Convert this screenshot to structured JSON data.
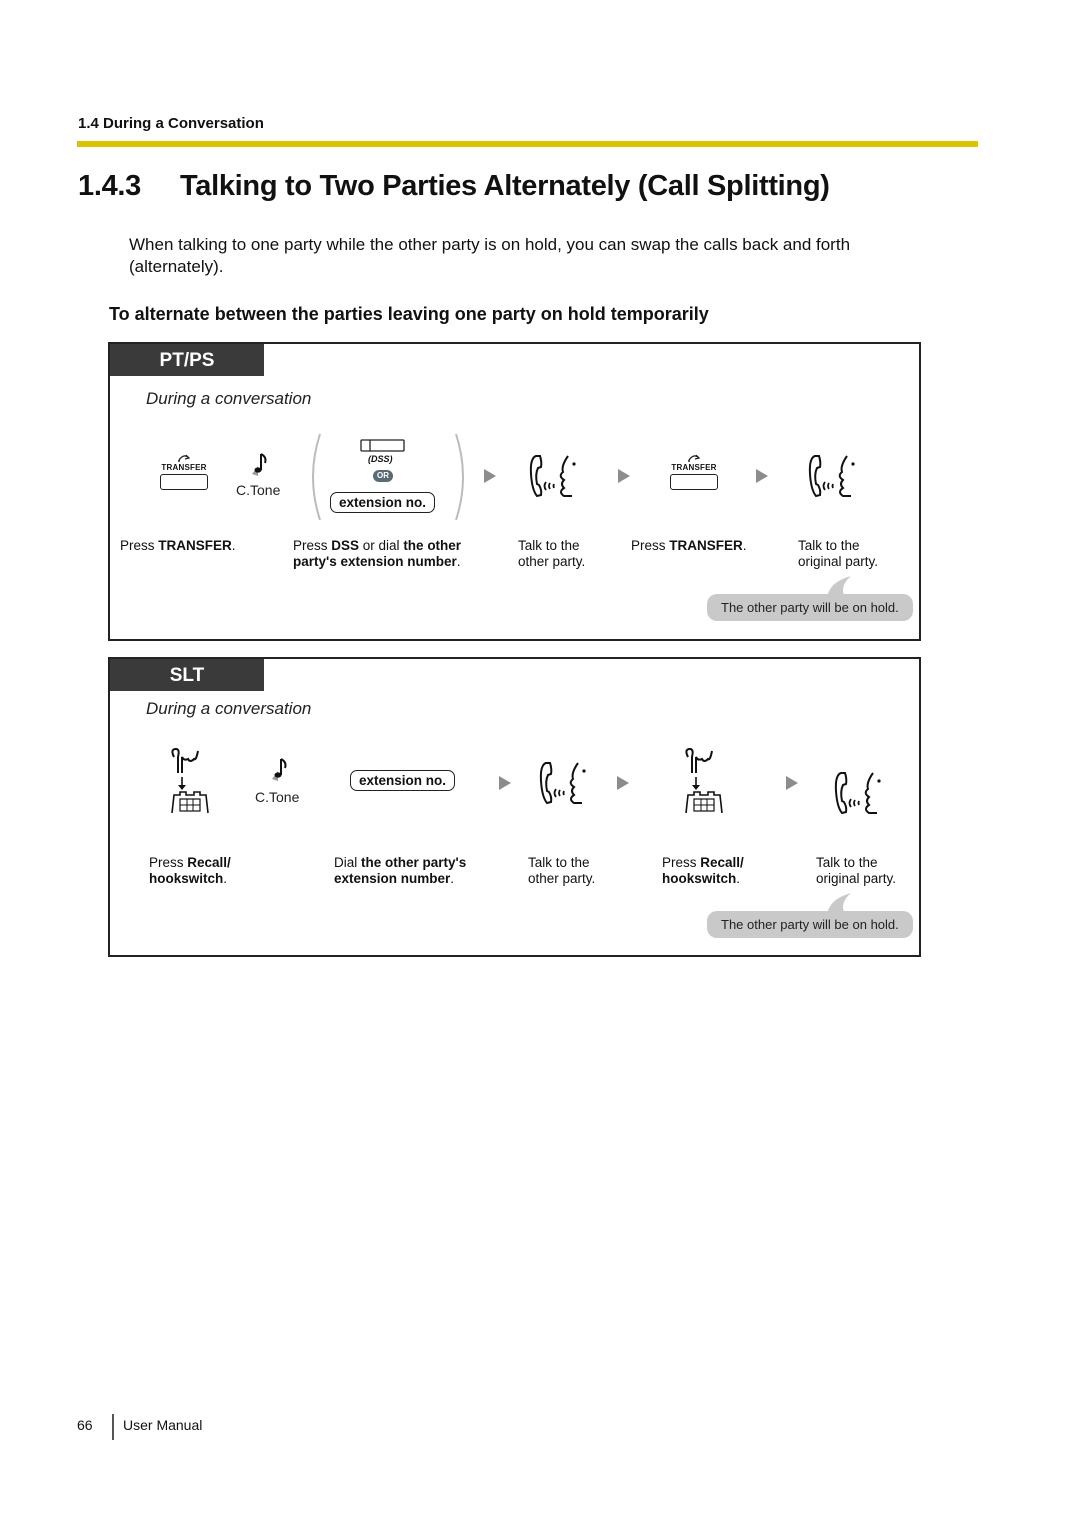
{
  "header": {
    "section": "1.4 During a Conversation",
    "accent_color": "#dcc200"
  },
  "title": {
    "number": "1.4.3",
    "text": "Talking to Two Parties Alternately (Call Splitting)"
  },
  "intro": "When talking to one party while the other party is on hold, you can swap the calls back and forth (alternately).",
  "subheading": "To alternate between the parties leaving one party on hold temporarily",
  "pt_panel": {
    "tag": "PT/PS",
    "condition": "During a conversation",
    "icons": {
      "transfer_label": "TRANSFER",
      "ctone_label": "C.Tone",
      "dss_label": "(DSS)",
      "or_label": "OR",
      "extension_label": "extension no."
    },
    "steps": [
      {
        "pre": "Press ",
        "bold": "TRANSFER",
        "post": "."
      },
      {
        "pre": "Press ",
        "bold": "DSS",
        "mid": " or dial ",
        "bold2": "the other party's extension number",
        "post": "."
      },
      {
        "line1": "Talk to the",
        "line2": "other party."
      },
      {
        "pre": "Press ",
        "bold": "TRANSFER",
        "post": "."
      },
      {
        "line1": "Talk to the",
        "line2": "original party."
      }
    ],
    "note": "The other party will be on hold."
  },
  "slt_panel": {
    "tag": "SLT",
    "condition": "During a conversation",
    "icons": {
      "ctone_label": "C.Tone",
      "extension_label": "extension no."
    },
    "steps": [
      {
        "pre": "Press ",
        "bold": "Recall/",
        "bold_line2": "hookswitch",
        "post": "."
      },
      {
        "pre": "Dial ",
        "bold": "the other party's",
        "bold_line2": "extension number",
        "post": "."
      },
      {
        "line1": "Talk to the",
        "line2": "other party."
      },
      {
        "pre": "Press ",
        "bold": "Recall/",
        "bold_line2": "hookswitch",
        "post": "."
      },
      {
        "line1": "Talk to the",
        "line2": "original party."
      }
    ],
    "note": "The other party will be on hold."
  },
  "footer": {
    "page_number": "66",
    "label": "User Manual"
  }
}
